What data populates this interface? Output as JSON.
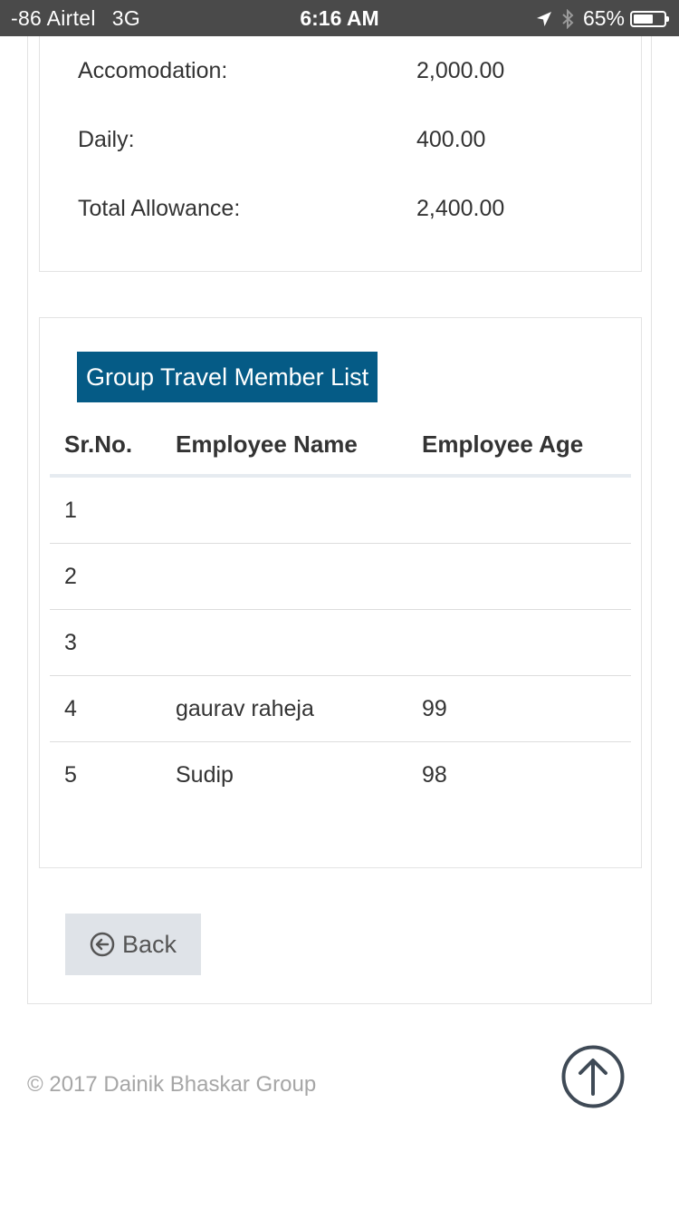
{
  "status_bar": {
    "carrier": "-86 Airtel",
    "network": "3G",
    "time": "6:16 AM",
    "battery_percent": "65%",
    "battery_level": 0.65,
    "icons": [
      "location-arrow-icon",
      "bluetooth-icon",
      "battery-icon"
    ]
  },
  "allowance": {
    "rows": [
      {
        "label": "Accomodation:",
        "value": "2,000.00"
      },
      {
        "label": "Daily:",
        "value": "400.00"
      },
      {
        "label": "Total Allowance:",
        "value": "2,400.00"
      }
    ]
  },
  "group_travel": {
    "title": "Group Travel Member List",
    "columns": {
      "sr_no": "Sr.No.",
      "employee_name": "Employee Name",
      "employee_age": "Employee Age"
    },
    "rows": [
      {
        "sr_no": "1",
        "name": "",
        "age": ""
      },
      {
        "sr_no": "2",
        "name": "",
        "age": ""
      },
      {
        "sr_no": "3",
        "name": "",
        "age": ""
      },
      {
        "sr_no": "4",
        "name": "gaurav raheja",
        "age": "99"
      },
      {
        "sr_no": "5",
        "name": "Sudip",
        "age": "98"
      }
    ]
  },
  "back_button": {
    "label": "Back",
    "icon": "circle-arrow-left-icon"
  },
  "footer": {
    "copyright": "© 2017 Dainik Bhaskar Group",
    "scroll_top_icon": "arrow-up-circle-icon"
  },
  "colors": {
    "status_bar_bg": "#4a4a4a",
    "title_bg": "#055b86",
    "button_bg": "#dfe3e8",
    "footer_text": "#a6a6a6"
  }
}
